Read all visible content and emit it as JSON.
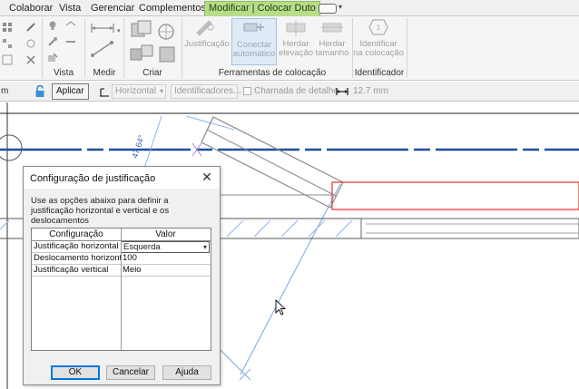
{
  "ribbon_tabs": [
    {
      "label": "Colaborar"
    },
    {
      "label": "Vista"
    },
    {
      "label": "Gerenciar"
    },
    {
      "label": "Complementos"
    },
    {
      "label": "Modificar | Colocar Duto",
      "active": true
    }
  ],
  "ribbon": {
    "panels": {
      "vista": "Vista",
      "medir": "Medir",
      "criar": "Criar",
      "ferramentas": "Ferramentas de colocação",
      "identificador": "Identificador"
    },
    "buttons": {
      "justificacao": "Justificação",
      "conectar_line1": "Conectar",
      "conectar_line2": "automático",
      "herdar_elevacao_line1": "Herdar",
      "herdar_elevacao_line2": "elevação",
      "herdar_tamanho_line1": "Herdar",
      "herdar_tamanho_line2": "tamanho",
      "identificar_line1": "Identificar",
      "identificar_line2": "na colocação"
    }
  },
  "options_bar": {
    "left_fragment": "m",
    "apply_button": "Aplicar",
    "orientation_select": "Horizontal",
    "identifiers_button": "Identificadores...",
    "detail_callout_label": "Chamada de detalhe",
    "length_value": "12.7 mm"
  },
  "canvas": {
    "angle_annotation": "47.64°"
  },
  "dialog": {
    "title": "Configuração de justificação",
    "close_glyph": "✕",
    "description": "Use as opções abaixo para definir a justificação horizontal e vertical e os deslocamentos",
    "grid": {
      "headers": {
        "config": "Configuração",
        "value": "Valor"
      },
      "rows": [
        {
          "config": "Justificação horizontal",
          "value": "Esquerda"
        },
        {
          "config": "Deslocamento horizont",
          "value": "100"
        },
        {
          "config": "Justificação vertical",
          "value": "Meio"
        }
      ]
    },
    "buttons": {
      "ok": "OK",
      "cancel": "Cancelar",
      "help": "Ajuda"
    }
  },
  "colors": {
    "active_tab": "#b8dc8a",
    "duct_red": "#e03030",
    "centerline_blue": "#1e4fa0",
    "ref_line_blue": "#8ab4e8",
    "dialog_default_border": "#0078d7"
  }
}
